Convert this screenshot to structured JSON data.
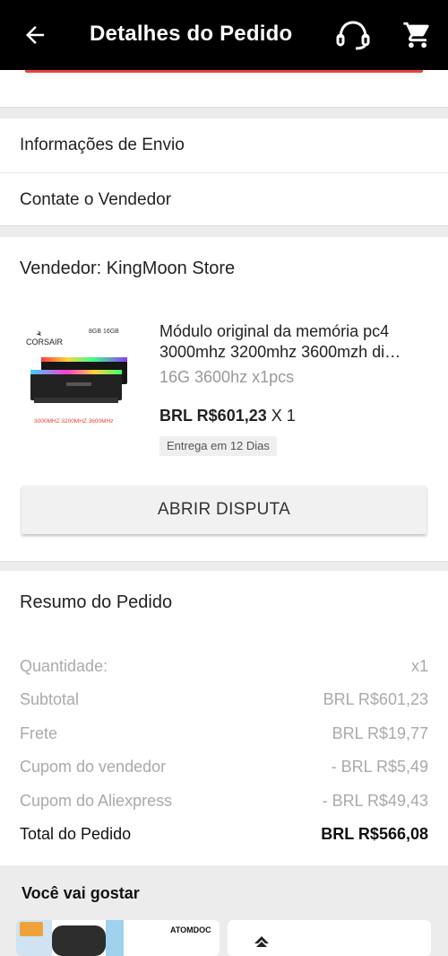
{
  "header": {
    "title": "Detalhes do Pedido"
  },
  "links": {
    "shipping": "Informações de Envio",
    "contact": "Contate o Vendedor"
  },
  "seller": {
    "label": "Vendedor: KingMoon Store",
    "product": {
      "title": "Módulo original da memória pc4 3000mhz 3200mhz 3600mzh di…",
      "variant": "16G 3600hz x1pcs",
      "price": "BRL R$601,23",
      "qty": "X 1",
      "delivery": "Entrega em 12 Dias",
      "thumb": {
        "brand": "CORSAIR",
        "sizes": "8GB  16GB",
        "speeds": "3000MHZ  3200MHZ  3600MHz"
      }
    },
    "dispute_label": "ABRIR DISPUTA"
  },
  "summary": {
    "title": "Resumo do Pedido",
    "rows": [
      {
        "label": "Quantidade:",
        "value": "x1"
      },
      {
        "label": "Subtotal",
        "value": "BRL R$601,23"
      },
      {
        "label": "Frete",
        "value": "BRL R$19,77"
      },
      {
        "label": "Cupom do vendedor",
        "value": "- BRL R$5,49"
      },
      {
        "label": "Cupom do Aliexpress",
        "value": "- BRL R$49,43"
      }
    ],
    "total": {
      "label": "Total do Pedido",
      "value": "BRL R$566,08"
    }
  },
  "recommend": {
    "title": "Você vai gostar",
    "card_brand": "ATOMDOC"
  },
  "colors": {
    "header_bg": "#000000",
    "accent_red": "#e8423a"
  },
  "icons": [
    "back-arrow-icon",
    "headset-icon",
    "cart-icon"
  ]
}
